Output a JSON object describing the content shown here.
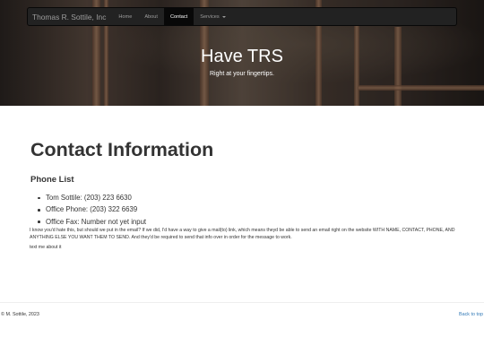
{
  "navbar": {
    "brand": "Thomas R. Sottile, Inc",
    "links": [
      {
        "label": "Home"
      },
      {
        "label": "About"
      },
      {
        "label": "Contact",
        "active": true
      },
      {
        "label": "Services"
      }
    ]
  },
  "hero": {
    "title": "Have TRS",
    "subtitle": "Right at your fingertips."
  },
  "main": {
    "title": "Contact Information",
    "section_title": "Phone List",
    "phones": [
      "Tom Sottile: (203) 223 6630",
      "Office Phone: (203) 322 6639",
      "Office Fax: Number not yet input"
    ],
    "note": "I know you'd hate this, but should we put in the email? If we did, I'd have a way to give a mail(to) link, which means theyd be able to send an email right on the website WITH NAME, CONTACT, PHONE, AND ANYTHING ELSE YOU WANT THEM TO SEND. And they'd be required to send that info over in order for the message to work.",
    "note2": "text me about it"
  },
  "footer": {
    "copyright": "© M. Sottile, 2023",
    "back_to_top": "Back to top"
  },
  "colors": {
    "navbar_bg": "#222222",
    "nav_active_bg": "#080808",
    "link": "#337ab7",
    "text": "#333333"
  }
}
